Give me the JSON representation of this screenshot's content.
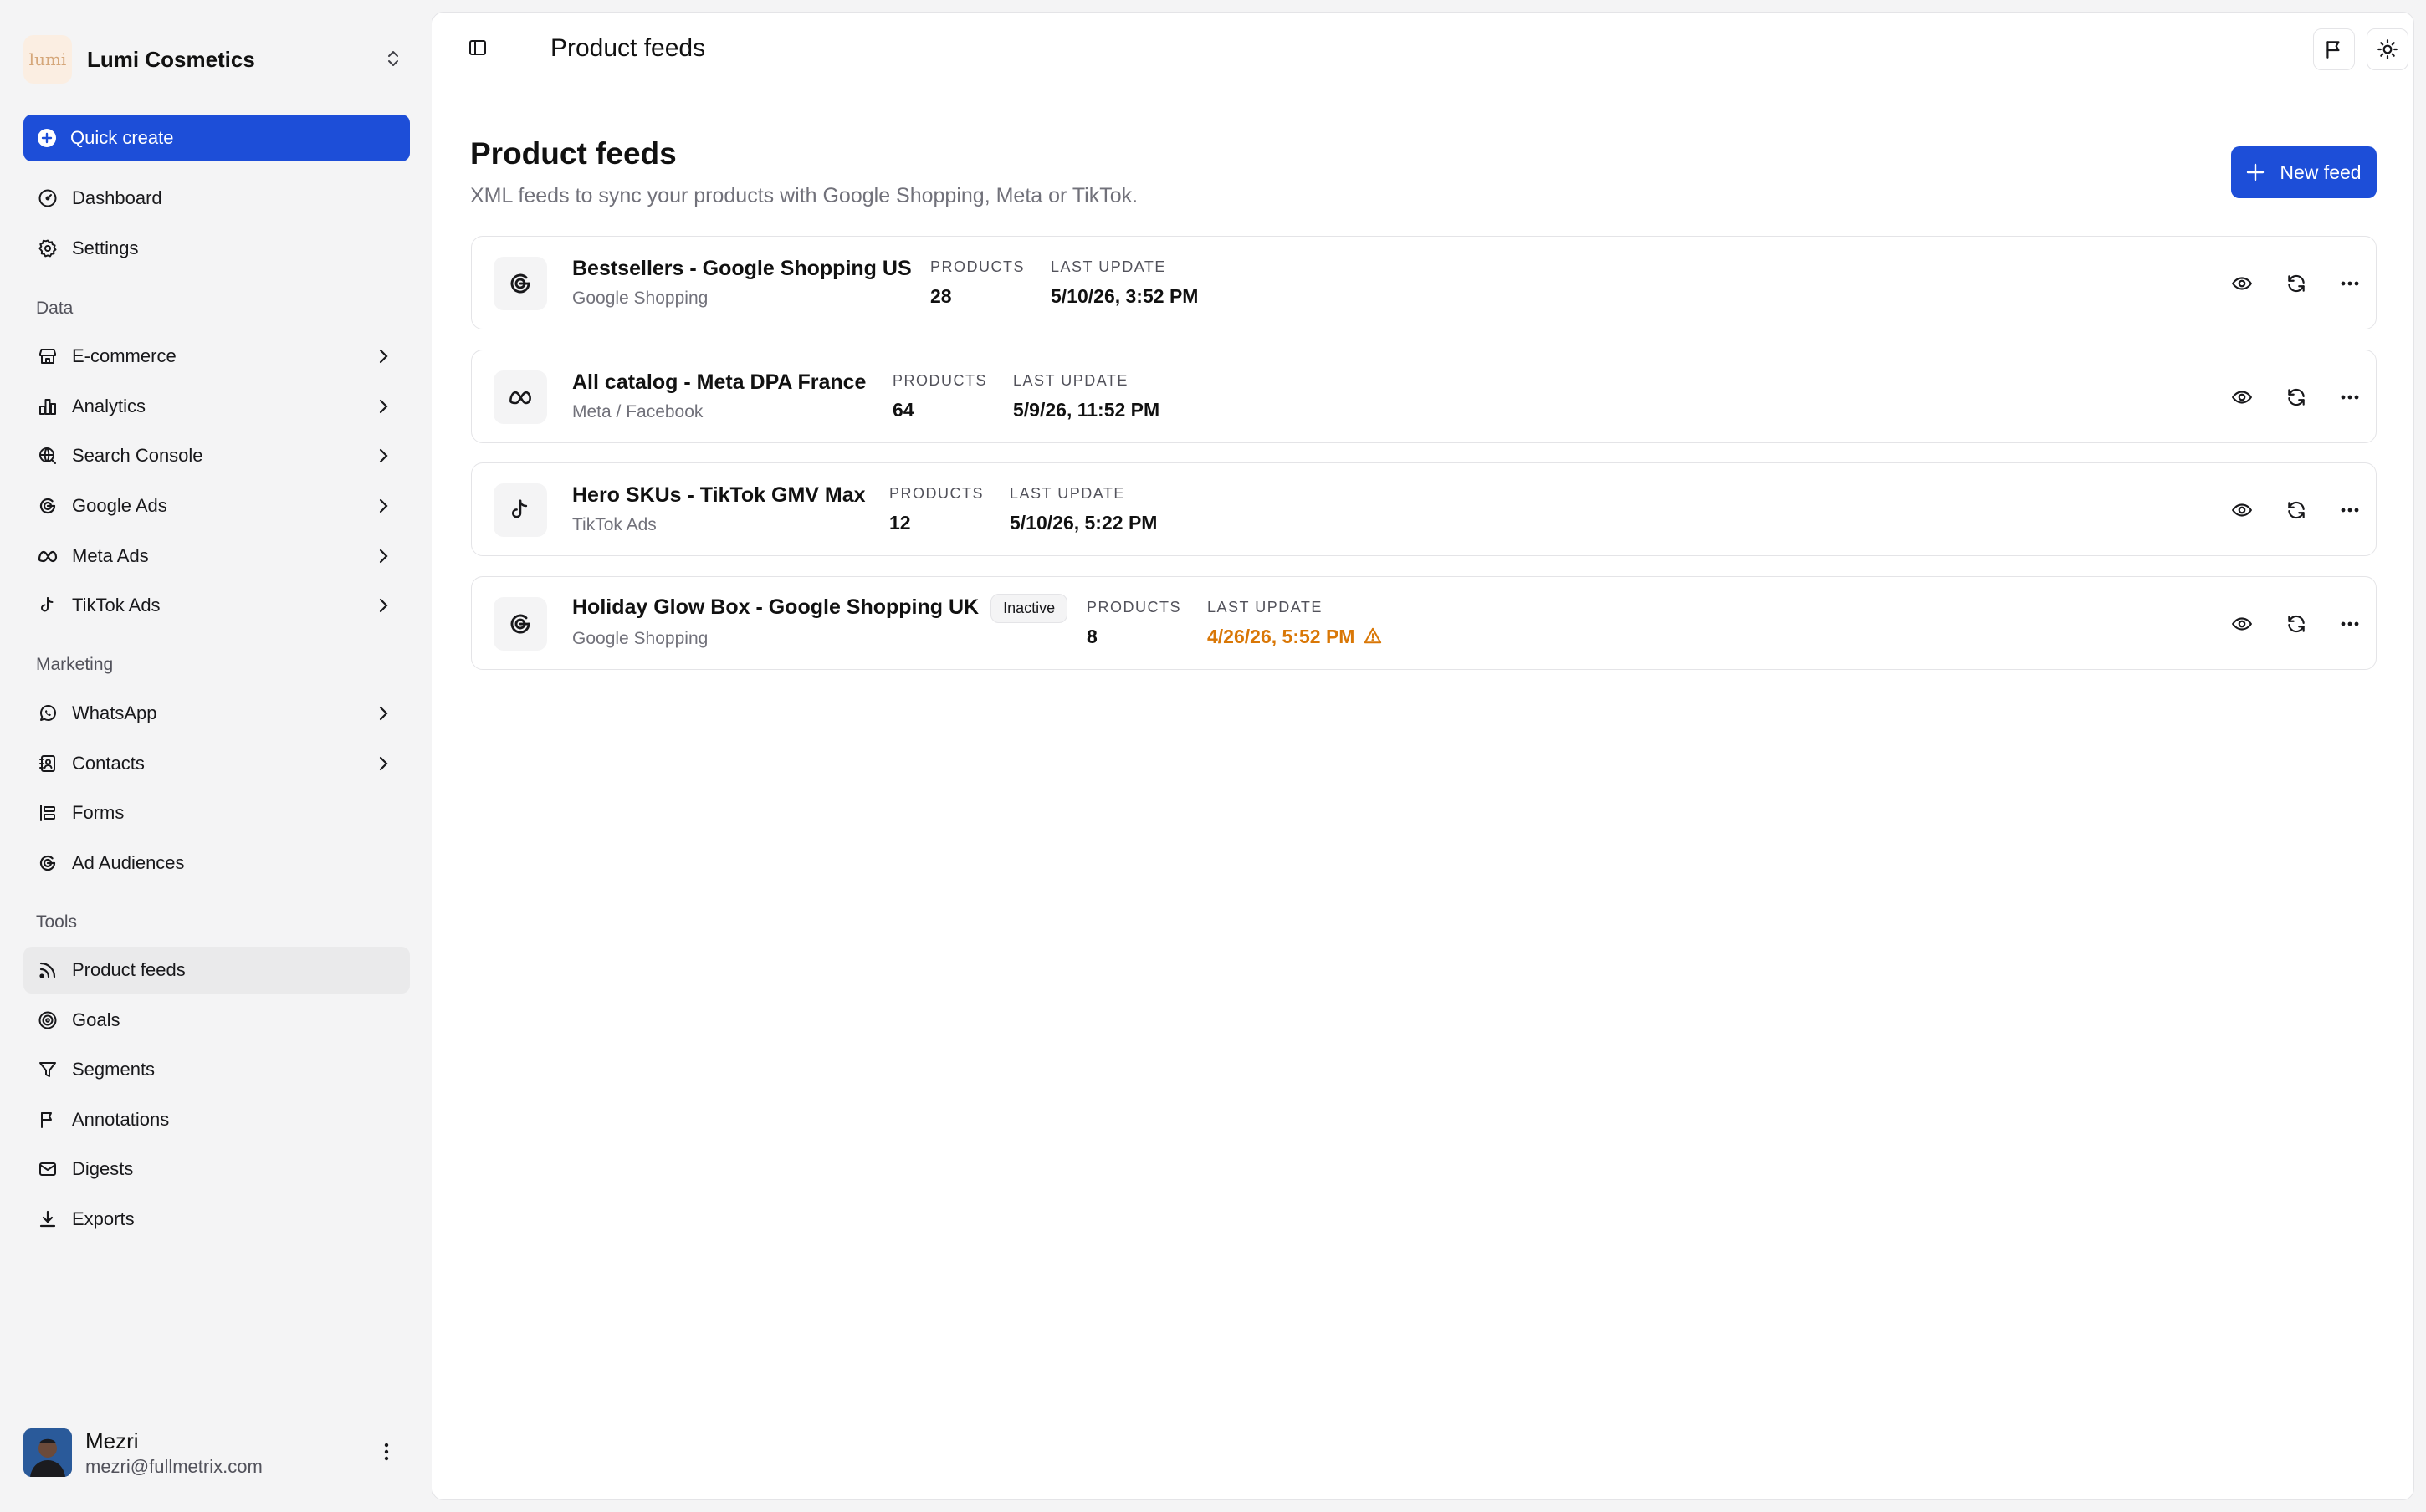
{
  "org": {
    "name": "Lumi Cosmetics",
    "logo_text": "lumi"
  },
  "sidebar": {
    "quick_create": "Quick create",
    "top_items": [
      {
        "label": "Dashboard",
        "icon": "dashboard-icon"
      },
      {
        "label": "Settings",
        "icon": "gear-icon"
      }
    ],
    "sections": {
      "data": "Data",
      "marketing": "Marketing",
      "tools": "Tools"
    },
    "data_items": [
      {
        "label": "E-commerce",
        "icon": "store-icon"
      },
      {
        "label": "Analytics",
        "icon": "bar-chart-icon"
      },
      {
        "label": "Search Console",
        "icon": "search-globe-icon"
      },
      {
        "label": "Google Ads",
        "icon": "google-icon"
      },
      {
        "label": "Meta Ads",
        "icon": "meta-icon"
      },
      {
        "label": "TikTok Ads",
        "icon": "tiktok-icon"
      }
    ],
    "marketing_items": [
      {
        "label": "WhatsApp",
        "icon": "whatsapp-icon"
      },
      {
        "label": "Contacts",
        "icon": "contacts-icon"
      },
      {
        "label": "Forms",
        "icon": "form-icon"
      },
      {
        "label": "Ad Audiences",
        "icon": "google-icon"
      }
    ],
    "tools_items": [
      {
        "label": "Product feeds",
        "icon": "rss-icon",
        "active": true
      },
      {
        "label": "Goals",
        "icon": "target-icon"
      },
      {
        "label": "Segments",
        "icon": "filter-icon"
      },
      {
        "label": "Annotations",
        "icon": "flag-icon"
      },
      {
        "label": "Digests",
        "icon": "mail-icon"
      },
      {
        "label": "Exports",
        "icon": "download-icon"
      }
    ]
  },
  "user": {
    "name": "Mezri",
    "email": "mezri@fullmetrix.com"
  },
  "header": {
    "title": "Product feeds"
  },
  "page": {
    "title": "Product feeds",
    "subtitle": "XML feeds to sync your products with Google Shopping, Meta or TikTok.",
    "new_button": "New feed"
  },
  "labels": {
    "products": "PRODUCTS",
    "last_update": "LAST UPDATE"
  },
  "feeds": [
    {
      "name": "Bestsellers - Google Shopping US",
      "platform": "Google Shopping",
      "icon": "google-icon",
      "products": "28",
      "last_update": "5/10/26, 3:52 PM"
    },
    {
      "name": "All catalog - Meta DPA France",
      "platform": "Meta / Facebook",
      "icon": "meta-icon",
      "products": "64",
      "last_update": "5/9/26, 11:52 PM"
    },
    {
      "name": "Hero SKUs - TikTok GMV Max",
      "platform": "TikTok Ads",
      "icon": "tiktok-icon",
      "products": "12",
      "last_update": "5/10/26, 5:22 PM"
    },
    {
      "name": "Holiday Glow Box - Google Shopping UK",
      "platform": "Google Shopping",
      "icon": "google-icon",
      "badge": "Inactive",
      "products": "8",
      "last_update": "4/26/26, 5:52 PM",
      "warning": true
    }
  ],
  "colors": {
    "accent": "#1d4ed8",
    "warning": "#d97706"
  }
}
